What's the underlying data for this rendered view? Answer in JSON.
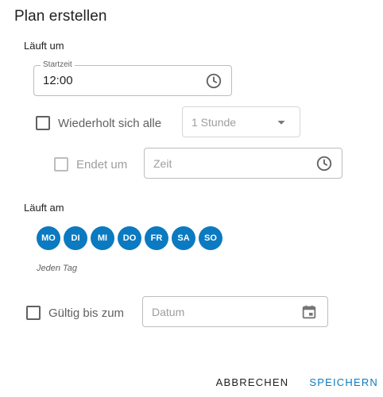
{
  "dialog": {
    "title": "Plan erstellen"
  },
  "runs_at": {
    "label": "Läuft um",
    "start_time": {
      "legend": "Startzeit",
      "value": "12:00",
      "icon": "clock-icon"
    }
  },
  "repeat": {
    "label": "Wiederholt sich alle",
    "checked": false,
    "interval": {
      "value": "1 Stunde",
      "icon": "chevron-down-icon"
    }
  },
  "ends": {
    "label": "Endet um",
    "checked": false,
    "time": {
      "placeholder": "Zeit",
      "icon": "clock-icon"
    }
  },
  "runs_on": {
    "label": "Läuft am",
    "days": [
      "MO",
      "DI",
      "MI",
      "DO",
      "FR",
      "SA",
      "SO"
    ],
    "hint": "Jeden Tag"
  },
  "valid_until": {
    "label": "Gültig bis zum",
    "checked": false,
    "date": {
      "placeholder": "Datum",
      "icon": "calendar-icon"
    }
  },
  "actions": {
    "cancel_label": "ABBRECHEN",
    "save_label": "SPEICHERN"
  },
  "colors": {
    "accent": "#0b7ac0",
    "border": "#bdbdbd",
    "muted": "#9e9e9e"
  }
}
